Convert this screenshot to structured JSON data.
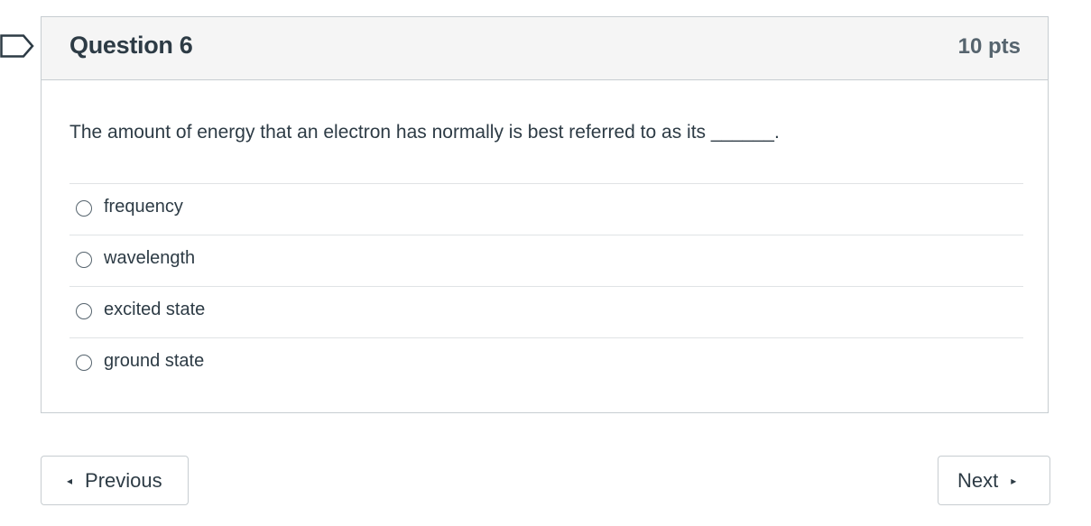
{
  "question": {
    "title": "Question 6",
    "points": "10 pts",
    "text": "The amount of energy that an electron has normally is best referred to as its ______.",
    "answers": [
      {
        "label": "frequency",
        "selected": false
      },
      {
        "label": "wavelength",
        "selected": false
      },
      {
        "label": "excited state",
        "selected": false
      },
      {
        "label": "ground state",
        "selected": false
      }
    ]
  },
  "nav": {
    "previous_label": "Previous",
    "next_label": "Next",
    "previous_icon": "◂",
    "next_icon": "▸"
  },
  "icons": {
    "flag": "flag-question-icon"
  }
}
